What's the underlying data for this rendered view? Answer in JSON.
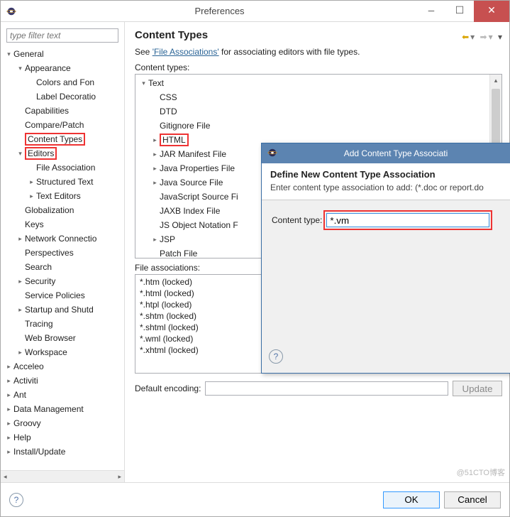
{
  "window": {
    "title": "Preferences"
  },
  "filter": {
    "placeholder": "type filter text"
  },
  "leftTree": [
    {
      "indent": 0,
      "arrow": "▾",
      "label": "General",
      "boxed": false
    },
    {
      "indent": 1,
      "arrow": "▾",
      "label": "Appearance",
      "boxed": false
    },
    {
      "indent": 2,
      "arrow": "",
      "label": "Colors and Fon",
      "boxed": false
    },
    {
      "indent": 2,
      "arrow": "",
      "label": "Label Decoratio",
      "boxed": false
    },
    {
      "indent": 1,
      "arrow": "",
      "label": "Capabilities",
      "boxed": false
    },
    {
      "indent": 1,
      "arrow": "",
      "label": "Compare/Patch",
      "boxed": false
    },
    {
      "indent": 1,
      "arrow": "",
      "label": "Content Types",
      "boxed": true
    },
    {
      "indent": 1,
      "arrow": "▾",
      "label": "Editors",
      "boxed": true
    },
    {
      "indent": 2,
      "arrow": "",
      "label": "File Association",
      "boxed": false
    },
    {
      "indent": 2,
      "arrow": "▸",
      "label": "Structured Text",
      "boxed": false
    },
    {
      "indent": 2,
      "arrow": "▸",
      "label": "Text Editors",
      "boxed": false
    },
    {
      "indent": 1,
      "arrow": "",
      "label": "Globalization",
      "boxed": false
    },
    {
      "indent": 1,
      "arrow": "",
      "label": "Keys",
      "boxed": false
    },
    {
      "indent": 1,
      "arrow": "▸",
      "label": "Network Connectio",
      "boxed": false
    },
    {
      "indent": 1,
      "arrow": "",
      "label": "Perspectives",
      "boxed": false
    },
    {
      "indent": 1,
      "arrow": "",
      "label": "Search",
      "boxed": false
    },
    {
      "indent": 1,
      "arrow": "▸",
      "label": "Security",
      "boxed": false
    },
    {
      "indent": 1,
      "arrow": "",
      "label": "Service Policies",
      "boxed": false
    },
    {
      "indent": 1,
      "arrow": "▸",
      "label": "Startup and Shutd",
      "boxed": false
    },
    {
      "indent": 1,
      "arrow": "",
      "label": "Tracing",
      "boxed": false
    },
    {
      "indent": 1,
      "arrow": "",
      "label": "Web Browser",
      "boxed": false
    },
    {
      "indent": 1,
      "arrow": "▸",
      "label": "Workspace",
      "boxed": false
    },
    {
      "indent": 0,
      "arrow": "▸",
      "label": "Acceleo",
      "boxed": false
    },
    {
      "indent": 0,
      "arrow": "▸",
      "label": "Activiti",
      "boxed": false
    },
    {
      "indent": 0,
      "arrow": "▸",
      "label": "Ant",
      "boxed": false
    },
    {
      "indent": 0,
      "arrow": "▸",
      "label": "Data Management",
      "boxed": false
    },
    {
      "indent": 0,
      "arrow": "▸",
      "label": "Groovy",
      "boxed": false
    },
    {
      "indent": 0,
      "arrow": "▸",
      "label": "Help",
      "boxed": false
    },
    {
      "indent": 0,
      "arrow": "▸",
      "label": "Install/Update",
      "boxed": false
    }
  ],
  "rightPane": {
    "title": "Content Types",
    "desc_prefix": "See ",
    "desc_link": "'File Associations'",
    "desc_suffix": " for associating editors with file types.",
    "contentTypesLabel": "Content types:",
    "contentTree": [
      {
        "indent": 0,
        "arrow": "▾",
        "label": "Text",
        "boxed": false
      },
      {
        "indent": 1,
        "arrow": "",
        "label": "CSS",
        "boxed": false
      },
      {
        "indent": 1,
        "arrow": "",
        "label": "DTD",
        "boxed": false
      },
      {
        "indent": 1,
        "arrow": "",
        "label": "Gitignore File",
        "boxed": false
      },
      {
        "indent": 1,
        "arrow": "▸",
        "label": "HTML",
        "boxed": true
      },
      {
        "indent": 1,
        "arrow": "▸",
        "label": "JAR Manifest File",
        "boxed": false
      },
      {
        "indent": 1,
        "arrow": "▸",
        "label": "Java Properties File",
        "boxed": false
      },
      {
        "indent": 1,
        "arrow": "▸",
        "label": "Java Source File",
        "boxed": false
      },
      {
        "indent": 1,
        "arrow": "",
        "label": "JavaScript Source Fi",
        "boxed": false
      },
      {
        "indent": 1,
        "arrow": "",
        "label": "JAXB Index File",
        "boxed": false
      },
      {
        "indent": 1,
        "arrow": "",
        "label": "JS Object Notation F",
        "boxed": false
      },
      {
        "indent": 1,
        "arrow": "▸",
        "label": "JSP",
        "boxed": false
      },
      {
        "indent": 1,
        "arrow": "",
        "label": "Patch File",
        "boxed": false
      }
    ],
    "faLabel": "File associations:",
    "faItems": [
      "*.htm (locked)",
      "*.html (locked)",
      "*.htpl (locked)",
      "*.shtm (locked)",
      "*.shtml (locked)",
      "*.wml (locked)",
      "*.xhtml (locked)"
    ],
    "enc_label": "Default encoding:",
    "enc_btn": "Update"
  },
  "modal": {
    "title": "Add Content Type Associati",
    "heading": "Define New Content Type Association",
    "instruction": "Enter content type association to add: (*.doc or report.do",
    "field_label": "Content type:",
    "value": "*.vm"
  },
  "buttons": {
    "ok": "OK",
    "cancel": "Cancel"
  },
  "watermark": "@51CTO博客"
}
